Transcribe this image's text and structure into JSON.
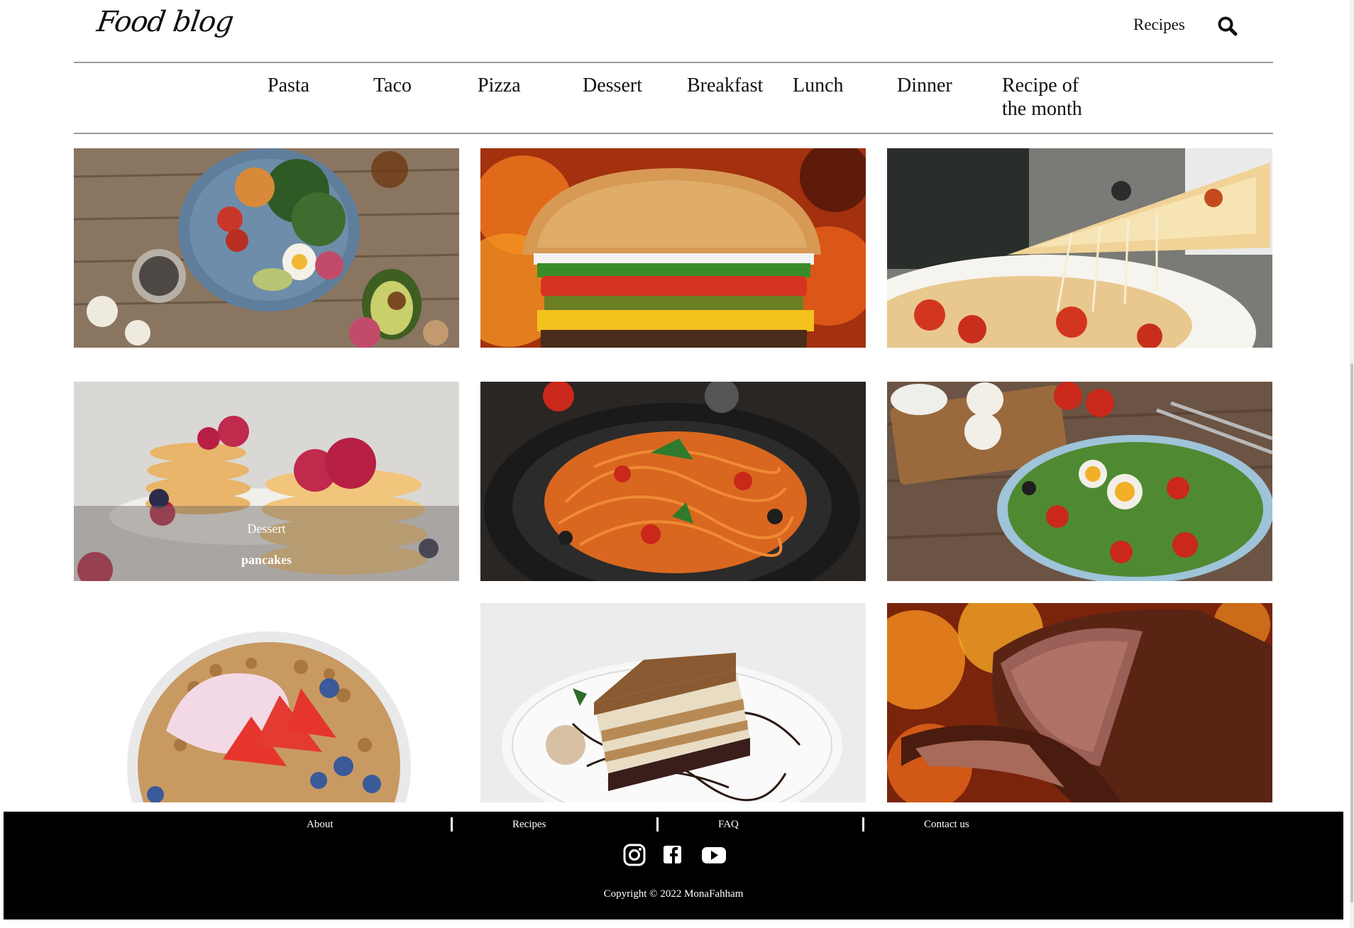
{
  "header": {
    "logo": "Food blog",
    "recipes_link": "Recipes",
    "search_icon": "search-icon"
  },
  "categories": [
    "Pasta",
    "Taco",
    "Pizza",
    "Dessert",
    "Breakfast",
    "Lunch",
    "Dinner",
    "Recipe of",
    "the month"
  ],
  "grid": {
    "featured": {
      "category": "Dessert",
      "name": "pancakes"
    },
    "tiles": [
      "healthy-bowl",
      "burger",
      "pizza",
      "pancakes",
      "spaghetti",
      "egg-salad",
      "yogurt-granola",
      "layer-cake",
      "roast-beef"
    ]
  },
  "footer": {
    "links": [
      "About",
      "Recipes",
      "FAQ",
      "Contact us"
    ],
    "social": [
      "instagram-icon",
      "facebook-icon",
      "youtube-icon"
    ],
    "copyright": "Copyright © 2022 MonaFahham"
  },
  "colors": {
    "footer_bg": "#000000",
    "text": "#111111",
    "rule": "#9a9a9a"
  }
}
